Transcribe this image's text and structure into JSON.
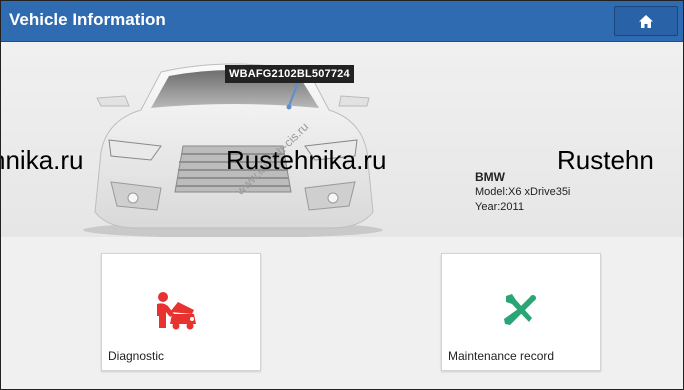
{
  "header": {
    "title": "Vehicle Information",
    "home_icon": "home-icon"
  },
  "vehicle": {
    "vin": "WBAFG2102BL507724",
    "make": "BMW",
    "model": "Model:X6 xDrive35i",
    "year": "Year:2011"
  },
  "watermarks": {
    "left": "hnika.ru",
    "center": "Rustehnika.ru",
    "right": "Rustehn",
    "diagonal": "www.launch-cis.ru"
  },
  "tiles": [
    {
      "label": "Diagnostic",
      "icon": "diagnostic-icon"
    },
    {
      "label": "Maintenance record",
      "icon": "maintenance-tools-icon"
    }
  ],
  "colors": {
    "header_bg": "#2f6bb0",
    "diagnostic_icon": "#e8322f",
    "maintenance_icon": "#2aa676"
  }
}
